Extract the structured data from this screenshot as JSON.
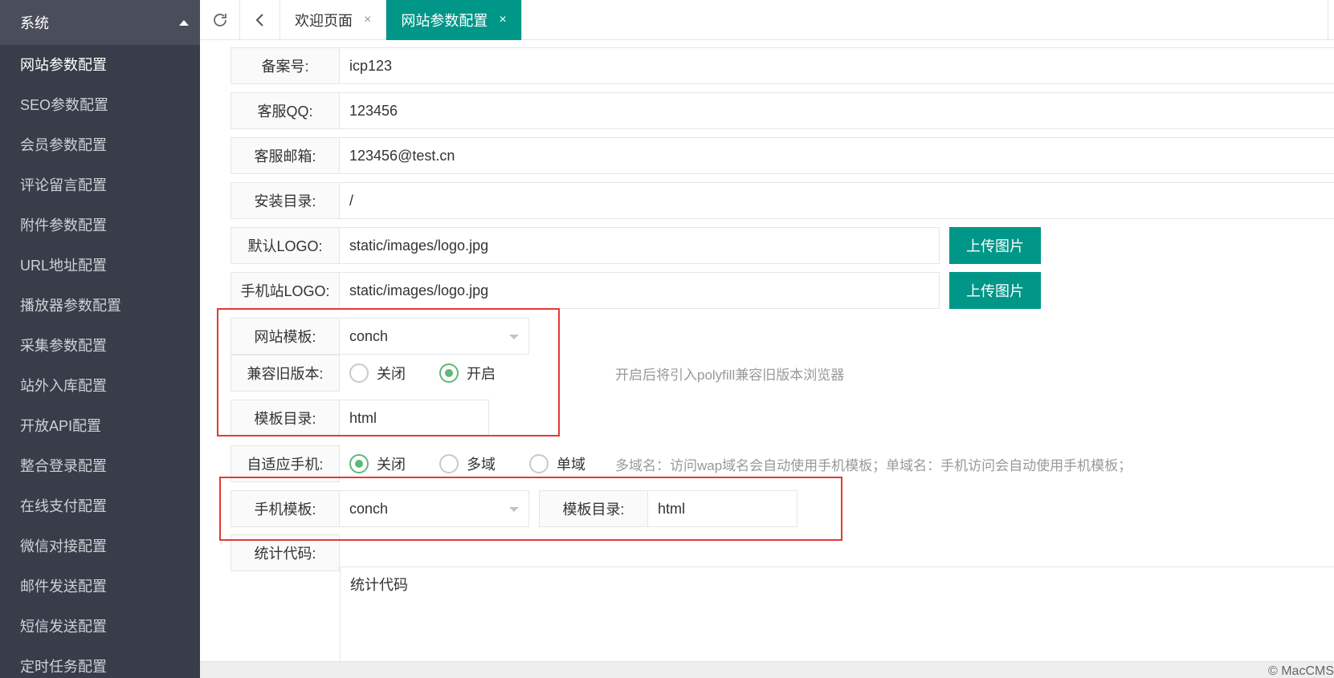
{
  "sidebar": {
    "header": "系统",
    "items": [
      {
        "label": "网站参数配置",
        "active": true
      },
      {
        "label": "SEO参数配置"
      },
      {
        "label": "会员参数配置"
      },
      {
        "label": "评论留言配置"
      },
      {
        "label": "附件参数配置"
      },
      {
        "label": "URL地址配置"
      },
      {
        "label": "播放器参数配置"
      },
      {
        "label": "采集参数配置"
      },
      {
        "label": "站外入库配置"
      },
      {
        "label": "开放API配置"
      },
      {
        "label": "整合登录配置"
      },
      {
        "label": "在线支付配置"
      },
      {
        "label": "微信对接配置"
      },
      {
        "label": "邮件发送配置"
      },
      {
        "label": "短信发送配置"
      },
      {
        "label": "定时任务配置"
      }
    ]
  },
  "tabs": [
    {
      "label": "欢迎页面",
      "close": "×"
    },
    {
      "label": "网站参数配置",
      "close": "×",
      "active": true
    }
  ],
  "form": {
    "icp": {
      "label": "备案号:",
      "value": "icp123"
    },
    "qq": {
      "label": "客服QQ:",
      "value": "123456"
    },
    "email": {
      "label": "客服邮箱:",
      "value": "123456@test.cn"
    },
    "install_dir": {
      "label": "安装目录:",
      "value": "/"
    },
    "logo": {
      "label": "默认LOGO:",
      "value": "static/images/logo.jpg",
      "button": "上传图片"
    },
    "mobile_logo": {
      "label": "手机站LOGO:",
      "value": "static/images/logo.jpg",
      "button": "上传图片"
    },
    "template": {
      "label": "网站模板:",
      "value": "conch"
    },
    "compat": {
      "label": "兼容旧版本:",
      "options": [
        "关闭",
        "开启"
      ],
      "selected": "开启",
      "hint": "开启后将引入polyfill兼容旧版本浏览器"
    },
    "template_dir": {
      "label": "模板目录:",
      "value": "html"
    },
    "adaptive": {
      "label": "自适应手机:",
      "options": [
        "关闭",
        "多域",
        "单域"
      ],
      "selected": "关闭",
      "hint": "多域名：访问wap域名会自动使用手机模板；单域名：手机访问会自动使用手机模板；"
    },
    "mobile_template": {
      "label": "手机模板:",
      "value": "conch"
    },
    "mobile_template_dir": {
      "label": "模板目录:",
      "value": "html"
    },
    "stat_code": {
      "label": "统计代码:",
      "value": "统计代码"
    }
  },
  "footer": {
    "copyright": "© MacCMS"
  },
  "colors": {
    "accent": "#009688",
    "sidebar_bg": "#393d49",
    "radio_on": "#5fb878",
    "highlight_box": "#e53935"
  }
}
